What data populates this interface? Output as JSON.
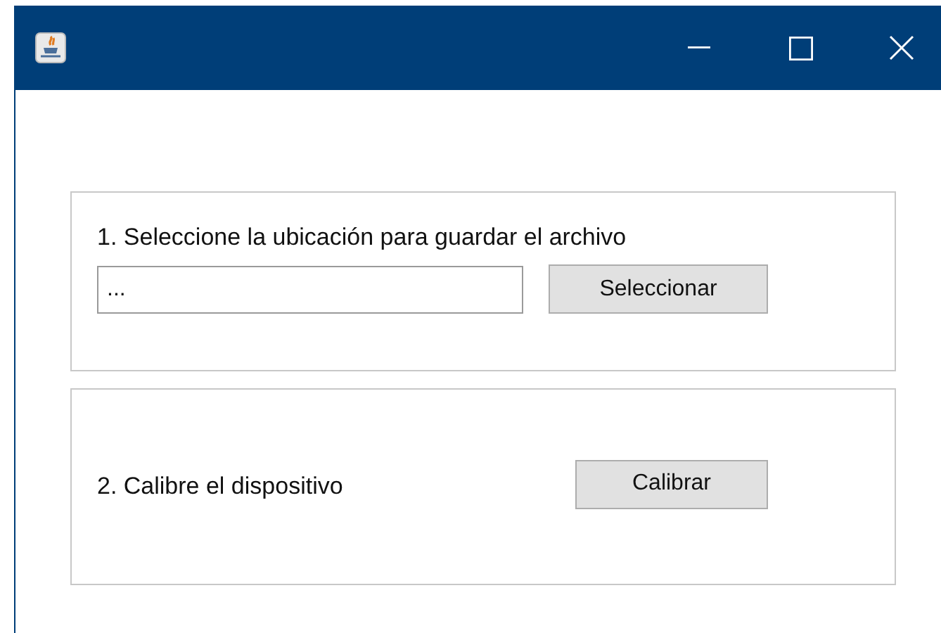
{
  "steps": [
    {
      "kind": "file",
      "label": "1. Seleccione la ubicación para guardar el archivo",
      "field": {
        "value": "..."
      },
      "button": "Seleccionar"
    },
    {
      "kind": "action",
      "label": "2. Calibre el dispositivo",
      "button": "Calibrar"
    }
  ]
}
